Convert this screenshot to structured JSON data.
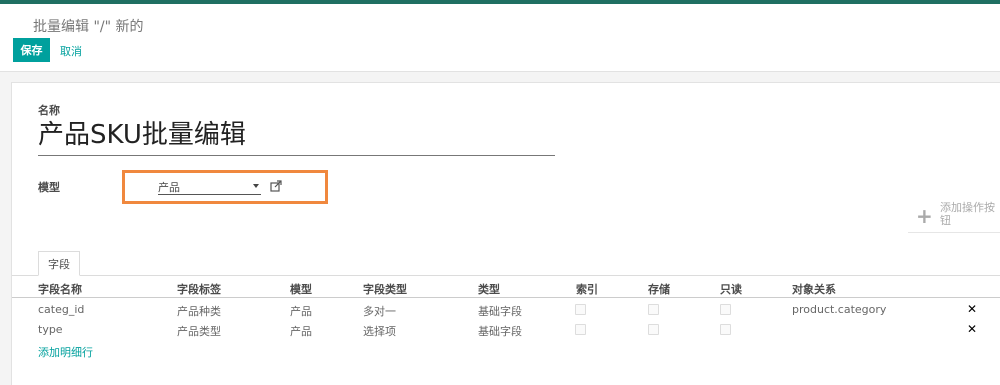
{
  "breadcrumb": "批量编辑 \"/\" 新的",
  "buttons": {
    "save": "保存",
    "cancel": "取消"
  },
  "form": {
    "name_label": "名称",
    "name_value": "产品SKU批量编辑",
    "model_label": "模型",
    "model_value": "产品"
  },
  "add_action_label": "添加操作按钮",
  "tab_label": "字段",
  "table": {
    "headers": [
      "字段名称",
      "字段标签",
      "模型",
      "字段类型",
      "类型",
      "索引",
      "存储",
      "只读",
      "对象关系"
    ],
    "rows": [
      {
        "name": "categ_id",
        "label": "产品种类",
        "model": "产品",
        "ftype": "多对一",
        "type": "基础字段",
        "index": false,
        "store": false,
        "readonly": false,
        "relation": "product.category"
      },
      {
        "name": "type",
        "label": "产品类型",
        "model": "产品",
        "ftype": "选择项",
        "type": "基础字段",
        "index": false,
        "store": false,
        "readonly": false,
        "relation": ""
      }
    ],
    "add_line": "添加明细行"
  },
  "colors": {
    "accent": "#00a09d",
    "highlight": "#f0883e",
    "topbar": "#1f6f62"
  }
}
